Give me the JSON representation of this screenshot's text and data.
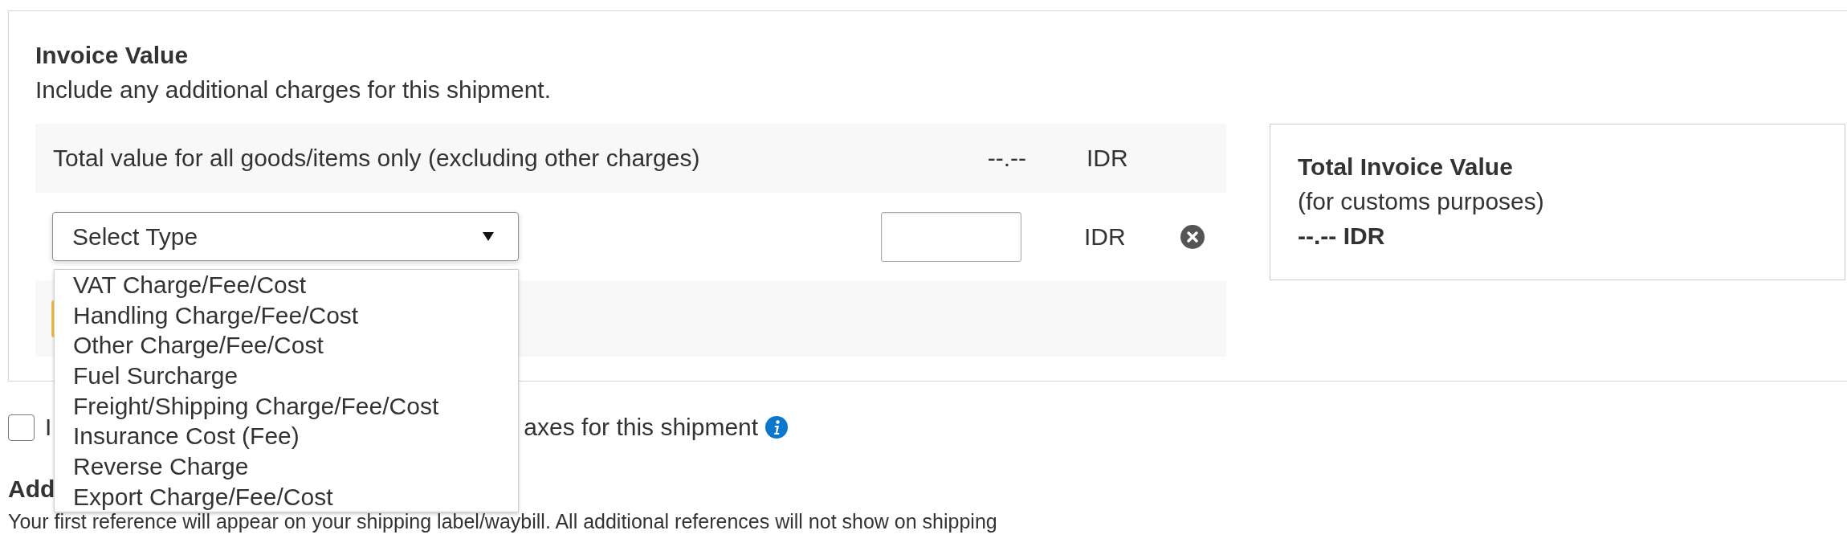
{
  "section": {
    "title": "Invoice Value",
    "subtitle": "Include any additional charges for this shipment."
  },
  "goods_row": {
    "label": "Total value for all goods/items only (excluding other charges)",
    "value": "--.--",
    "currency": "IDR"
  },
  "charge_row": {
    "type_select": {
      "placeholder": "Select Type",
      "expanded": true,
      "options": [
        {
          "label": "VAT Charge/Fee/Cost",
          "selected": false
        },
        {
          "label": "Handling Charge/Fee/Cost",
          "selected": false
        },
        {
          "label": "Other Charge/Fee/Cost",
          "selected": false
        },
        {
          "label": "Fuel Surcharge",
          "selected": false
        },
        {
          "label": "Freight/Shipping Charge/Fee/Cost",
          "selected": false
        },
        {
          "label": "Insurance Cost (Fee)",
          "selected": false
        },
        {
          "label": "Reverse Charge",
          "selected": false
        },
        {
          "label": "Export Charge/Fee/Cost",
          "selected": false
        }
      ]
    },
    "currency": "IDR"
  },
  "summary": {
    "title": "Total Invoice Value",
    "subtitle": "(for customs purposes)",
    "total": "--.-- IDR"
  },
  "duties_checkbox": {
    "checked": false,
    "label_visible": [
      "I",
      "axes for this shipment"
    ]
  },
  "references": {
    "title": "Add",
    "description": "Your first reference will appear on your shipping label/waybill. All additional references will not show on shipping"
  }
}
